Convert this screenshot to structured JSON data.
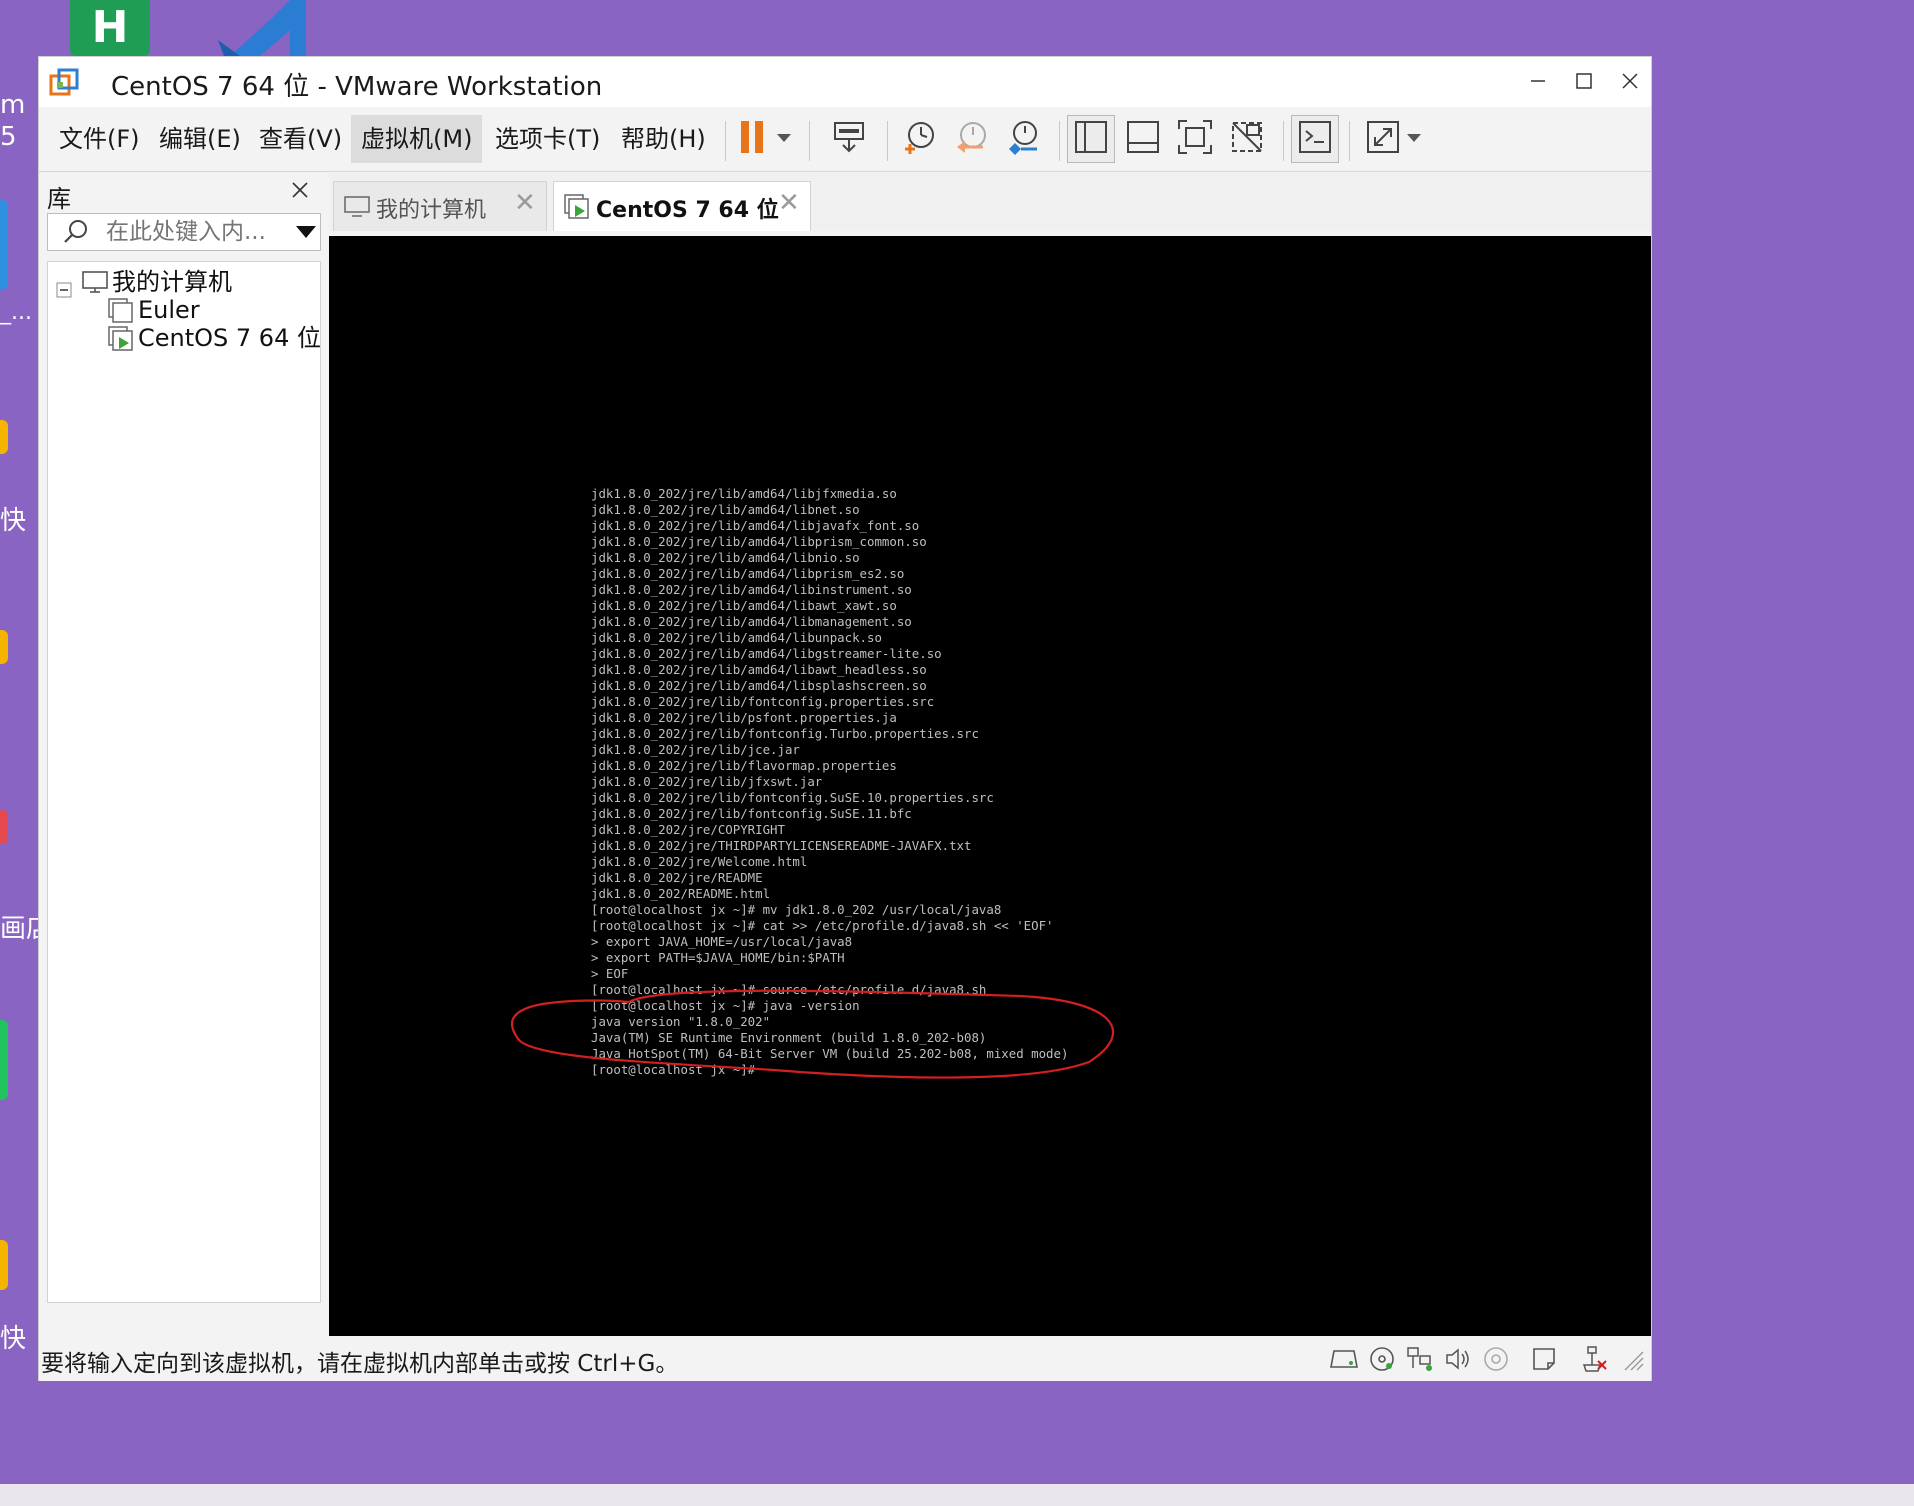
{
  "desktop": {
    "left_labels": [
      "m",
      "5",
      "_...",
      "快",
      "画店",
      "快"
    ]
  },
  "window": {
    "title": "CentOS 7 64 位 - VMware Workstation"
  },
  "menu": {
    "file": "文件(F)",
    "edit": "编辑(E)",
    "view": "查看(V)",
    "vm": "虚拟机(M)",
    "tabs": "选项卡(T)",
    "help": "帮助(H)"
  },
  "toolbar": {
    "icons": [
      "pause-icon",
      "send-keys-icon",
      "snapshot-icon",
      "revert-snapshot-icon",
      "snapshot-manager-icon",
      "show-library-icon",
      "thumbnail-bar-icon",
      "fullscreen-icon",
      "unity-icon",
      "console-view-icon",
      "stretch-guest-icon"
    ],
    "accent_color": "#e8741a"
  },
  "library": {
    "title": "库",
    "search_placeholder": "在此处键入内...",
    "tree": {
      "root": "我的计算机",
      "items": [
        "Euler",
        "CentOS 7 64 位"
      ]
    }
  },
  "tabs": [
    {
      "label": "我的计算机",
      "active": false
    },
    {
      "label": "CentOS 7 64 位",
      "active": true
    }
  ],
  "console": {
    "lines": [
      "jdk1.8.0_202/jre/lib/amd64/libjfxmedia.so",
      "jdk1.8.0_202/jre/lib/amd64/libnet.so",
      "jdk1.8.0_202/jre/lib/amd64/libjavafx_font.so",
      "jdk1.8.0_202/jre/lib/amd64/libprism_common.so",
      "jdk1.8.0_202/jre/lib/amd64/libnio.so",
      "jdk1.8.0_202/jre/lib/amd64/libprism_es2.so",
      "jdk1.8.0_202/jre/lib/amd64/libinstrument.so",
      "jdk1.8.0_202/jre/lib/amd64/libawt_xawt.so",
      "jdk1.8.0_202/jre/lib/amd64/libmanagement.so",
      "jdk1.8.0_202/jre/lib/amd64/libunpack.so",
      "jdk1.8.0_202/jre/lib/amd64/libgstreamer-lite.so",
      "jdk1.8.0_202/jre/lib/amd64/libawt_headless.so",
      "jdk1.8.0_202/jre/lib/amd64/libsplashscreen.so",
      "jdk1.8.0_202/jre/lib/fontconfig.properties.src",
      "jdk1.8.0_202/jre/lib/psfont.properties.ja",
      "jdk1.8.0_202/jre/lib/fontconfig.Turbo.properties.src",
      "jdk1.8.0_202/jre/lib/jce.jar",
      "jdk1.8.0_202/jre/lib/flavormap.properties",
      "jdk1.8.0_202/jre/lib/jfxswt.jar",
      "jdk1.8.0_202/jre/lib/fontconfig.SuSE.10.properties.src",
      "jdk1.8.0_202/jre/lib/fontconfig.SuSE.11.bfc",
      "jdk1.8.0_202/jre/COPYRIGHT",
      "jdk1.8.0_202/jre/THIRDPARTYLICENSEREADME-JAVAFX.txt",
      "jdk1.8.0_202/jre/Welcome.html",
      "jdk1.8.0_202/jre/README",
      "jdk1.8.0_202/README.html",
      "[root@localhost jx ~]# mv jdk1.8.0_202 /usr/local/java8",
      "[root@localhost jx ~]# cat >> /etc/profile.d/java8.sh << 'EOF'",
      "> export JAVA_HOME=/usr/local/java8",
      "> export PATH=$JAVA_HOME/bin:$PATH",
      "> EOF",
      "[root@localhost jx ~]# source /etc/profile.d/java8.sh",
      "[root@localhost jx ~]# java -version",
      "java version \"1.8.0_202\"",
      "Java(TM) SE Runtime Environment (build 1.8.0_202-b08)",
      "Java HotSpot(TM) 64-Bit Server VM (build 25.202-b08, mixed mode)",
      "[root@localhost jx ~]#"
    ],
    "annotation_color": "#d21f1f"
  },
  "statusbar": {
    "message": "要将输入定向到该虚拟机，请在虚拟机内部单击或按 Ctrl+G。",
    "icons": [
      "hard-disk-icon",
      "cd-rom-icon",
      "network-icon",
      "sound-icon",
      "cd-icon",
      "message-icon",
      "usb-disconnected-icon",
      "resize-grip-icon"
    ]
  }
}
